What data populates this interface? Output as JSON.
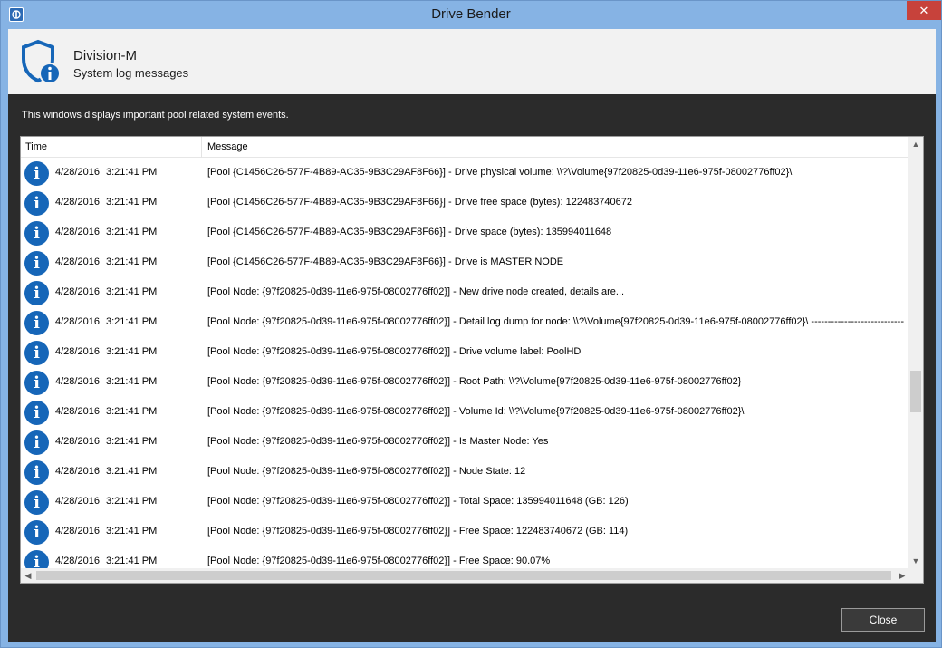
{
  "window": {
    "title": "Drive Bender",
    "close_glyph": "✕"
  },
  "header": {
    "company": "Division-M",
    "subtitle": "System log messages"
  },
  "description": "This windows displays important pool related system events.",
  "table": {
    "columns": {
      "time": "Time",
      "message": "Message"
    },
    "rows": [
      {
        "date": "4/28/2016",
        "time": "3:21:41 PM",
        "message": "[Pool {C1456C26-577F-4B89-AC35-9B3C29AF8F66}] - Drive physical volume: \\\\?\\Volume{97f20825-0d39-11e6-975f-08002776ff02}\\"
      },
      {
        "date": "4/28/2016",
        "time": "3:21:41 PM",
        "message": "[Pool {C1456C26-577F-4B89-AC35-9B3C29AF8F66}] - Drive free space (bytes): 122483740672"
      },
      {
        "date": "4/28/2016",
        "time": "3:21:41 PM",
        "message": "[Pool {C1456C26-577F-4B89-AC35-9B3C29AF8F66}] - Drive space (bytes): 135994011648"
      },
      {
        "date": "4/28/2016",
        "time": "3:21:41 PM",
        "message": "[Pool {C1456C26-577F-4B89-AC35-9B3C29AF8F66}] - Drive is MASTER NODE"
      },
      {
        "date": "4/28/2016",
        "time": "3:21:41 PM",
        "message": "[Pool Node: {97f20825-0d39-11e6-975f-08002776ff02}] - New drive node created, details are..."
      },
      {
        "date": "4/28/2016",
        "time": "3:21:41 PM",
        "message": "[Pool Node: {97f20825-0d39-11e6-975f-08002776ff02}] - Detail log dump for node: \\\\?\\Volume{97f20825-0d39-11e6-975f-08002776ff02}\\ ----------------------------"
      },
      {
        "date": "4/28/2016",
        "time": "3:21:41 PM",
        "message": "[Pool Node: {97f20825-0d39-11e6-975f-08002776ff02}] - Drive volume label: PoolHD"
      },
      {
        "date": "4/28/2016",
        "time": "3:21:41 PM",
        "message": "[Pool Node: {97f20825-0d39-11e6-975f-08002776ff02}] - Root Path: \\\\?\\Volume{97f20825-0d39-11e6-975f-08002776ff02}"
      },
      {
        "date": "4/28/2016",
        "time": "3:21:41 PM",
        "message": "[Pool Node: {97f20825-0d39-11e6-975f-08002776ff02}] - Volume Id: \\\\?\\Volume{97f20825-0d39-11e6-975f-08002776ff02}\\"
      },
      {
        "date": "4/28/2016",
        "time": "3:21:41 PM",
        "message": "[Pool Node: {97f20825-0d39-11e6-975f-08002776ff02}] - Is Master Node: Yes"
      },
      {
        "date": "4/28/2016",
        "time": "3:21:41 PM",
        "message": "[Pool Node: {97f20825-0d39-11e6-975f-08002776ff02}] - Node State: 12"
      },
      {
        "date": "4/28/2016",
        "time": "3:21:41 PM",
        "message": "[Pool Node: {97f20825-0d39-11e6-975f-08002776ff02}] - Total Space: 135994011648 (GB: 126)"
      },
      {
        "date": "4/28/2016",
        "time": "3:21:41 PM",
        "message": "[Pool Node: {97f20825-0d39-11e6-975f-08002776ff02}] - Free Space: 122483740672 (GB: 114)"
      },
      {
        "date": "4/28/2016",
        "time": "3:21:41 PM",
        "message": "[Pool Node: {97f20825-0d39-11e6-975f-08002776ff02}] - Free Space: 90.07%"
      }
    ],
    "row_icon": "info-icon"
  },
  "buttons": {
    "close": "Close"
  },
  "colors": {
    "titlebar": "#86b3e4",
    "accent": "#1666b8",
    "dark_bg": "#2b2b2b"
  }
}
